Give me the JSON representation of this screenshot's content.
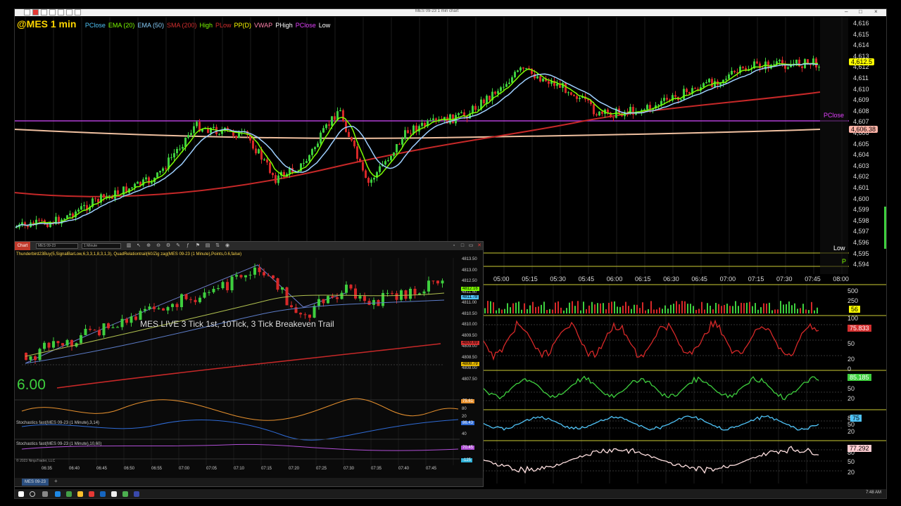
{
  "window": {
    "title": "MES 09-23 1 min chart",
    "controls": [
      "–",
      "□",
      "×"
    ]
  },
  "main_chart": {
    "symbol": "@MES 1 min",
    "legend": [
      {
        "label": "PClose",
        "color": "#4fc3f7"
      },
      {
        "label": "EMA (20)",
        "color": "#7cfc00"
      },
      {
        "label": "EMA (50)",
        "color": "#87cefa"
      },
      {
        "label": "SMA (200)",
        "color": "#d32f2f"
      },
      {
        "label": "High",
        "color": "#7cfc00"
      },
      {
        "label": "PLow",
        "color": "#d32f2f"
      },
      {
        "label": "PP(D)",
        "color": "#ffff00"
      },
      {
        "label": "VWAP",
        "color": "#ff80ab"
      },
      {
        "label": "PHigh",
        "color": "#ffffff"
      },
      {
        "label": "PClose",
        "color": "#e040fb"
      },
      {
        "label": "Low",
        "color": "#ffffff"
      }
    ],
    "price_ticks": [
      "4,616",
      "4,615",
      "4,614",
      "4,613",
      "4,612",
      "4,611",
      "4,610",
      "4,609",
      "4,608",
      "4,607",
      "4,606",
      "4,605",
      "4,604",
      "4,603",
      "4,602",
      "4,601",
      "4,600",
      "4,599",
      "4,598",
      "4,597",
      "4,596",
      "4,595",
      "4,594"
    ],
    "last_price": "4,612.5",
    "vwap_price": "4,606.38",
    "level_labels": {
      "pclose": "PClose",
      "low": "Low",
      "pp": "P"
    },
    "time_ticks": [
      "05:00",
      "05:15",
      "05:30",
      "05:45",
      "06:00",
      "06:15",
      "06:30",
      "06:45",
      "07:00",
      "07:15",
      "07:30",
      "07:45",
      "08:00"
    ]
  },
  "right_indicators": {
    "volume": {
      "scale": [
        "500",
        "250",
        "100"
      ],
      "value": "56"
    },
    "osc1": {
      "scale": [
        "100",
        "80",
        "50",
        "20",
        "0"
      ],
      "value": "75.833"
    },
    "osc2": {
      "scale": [
        "80",
        "50",
        "20"
      ],
      "value": "85.185"
    },
    "osc3": {
      "scale": [
        "80",
        "50",
        "20"
      ],
      "value": "75"
    },
    "osc4": {
      "scale": [
        "80",
        "50",
        "20"
      ],
      "value": "77.292"
    }
  },
  "nt_window": {
    "chart_button": "Chart",
    "instrument": "MES 09-23",
    "interval": "1 Minute",
    "indicators_text": "Thunderbird23Buy(5,SignalBarLow,6,3,3,1,8,3,1,3), QuadRelationtrail(60/Zig zag(MES 09-23 (1 Minute),Points,0.6,false)",
    "overlay_text": "MES LIVE 3 Tick 1st, 10Tick, 3 Tick Breakeven Trail",
    "big_value": "6.00",
    "stoch1_label": "Stochastics fast(MES 09-23 (1 Minute),3,14)",
    "stoch2_label": "Stochastics fast(MES 09-23 (1 Minute),10,60)",
    "copyright": "© 2023 NinjaTrader, LLC",
    "price_ticks": [
      "4813.50",
      "4813.00",
      "4812.50",
      "4811.50",
      "4811.00",
      "4810.50",
      "4810.00",
      "4809.50",
      "4809.00",
      "4808.50",
      "4808.00",
      "4807.50"
    ],
    "price_flags": [
      {
        "text": "4812.16",
        "color": "#7cfc00"
      },
      {
        "text": "4811.78",
        "color": "#4fc3f7"
      },
      {
        "text": "4809.69",
        "color": "#d32f2f"
      },
      {
        "text": "4808.79",
        "color": "#e6b800"
      }
    ],
    "osc_flags": [
      {
        "text": "75.61",
        "color": "#e6902e"
      },
      {
        "text": "86.43",
        "color": "#2f6bd6"
      },
      {
        "text": "70.45",
        "color": "#b04fd6"
      },
      {
        "text": "-125",
        "color": "#2fb0d6"
      }
    ],
    "osc_scale": [
      "80",
      "20",
      "40"
    ],
    "time_ticks": [
      "06:35",
      "06:40",
      "06:45",
      "06:50",
      "06:55",
      "07:00",
      "07:05",
      "07:10",
      "07:15",
      "07:20",
      "07:25",
      "07:30",
      "07:35",
      "07:40",
      "07:45"
    ],
    "tab_label": "MES 09-23",
    "tab_add": "+"
  },
  "taskbar": {
    "clock": "7:48 AM"
  }
}
